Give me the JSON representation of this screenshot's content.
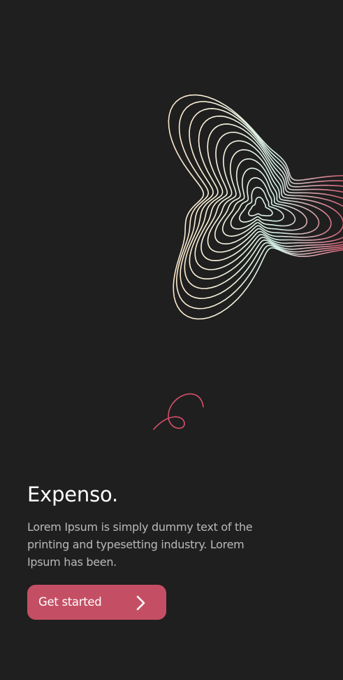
{
  "app": {
    "title": "Expenso.",
    "description": "Lorem Ipsum is simply dummy text of the printing and typesetting industry. Lorem Ipsum has been."
  },
  "cta": {
    "label": "Get started",
    "icon": "chevron-right-icon"
  },
  "colors": {
    "background": "#1f1f1f",
    "accent": "#c44f64",
    "text_primary": "#ffffff",
    "text_secondary": "#b9b9b9",
    "line_peach": "#f7c9a6",
    "line_cream": "#fdf4dc",
    "line_mint": "#d5f2ea",
    "line_rose": "#d7506a"
  }
}
